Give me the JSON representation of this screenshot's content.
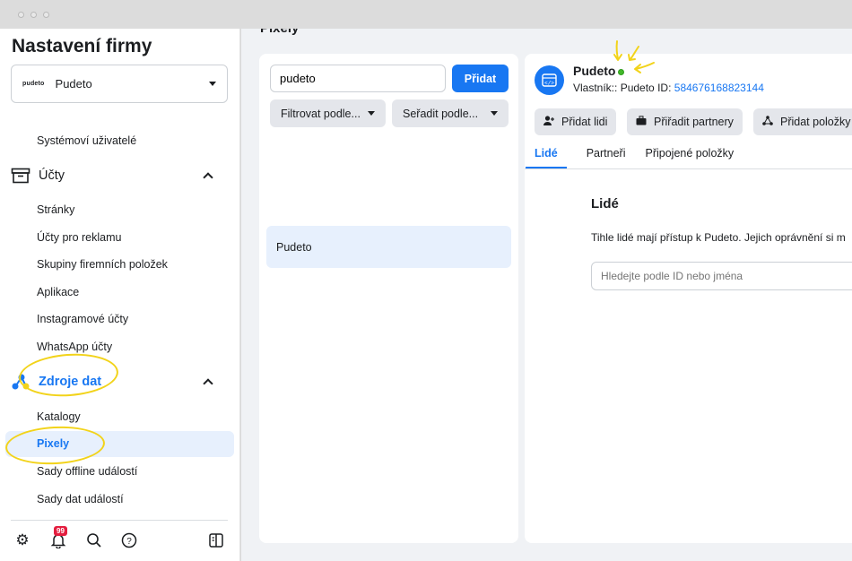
{
  "sidebar": {
    "title": "Nastavení firmy",
    "business": {
      "logo_text": "pudeto",
      "name": "Pudeto"
    },
    "system_users": "Systémoví uživatelé",
    "accounts_section": "Účty",
    "accounts_items": [
      "Stránky",
      "Účty pro reklamu",
      "Skupiny firemních položek",
      "Aplikace",
      "Instagramové účty",
      "WhatsApp účty"
    ],
    "data_sources_section": "Zdroje dat",
    "data_sources_items": [
      "Katalogy",
      "Pixely",
      "Sady offline událostí",
      "Sady dat událostí"
    ],
    "active_item": "Pixely",
    "footer": {
      "notification_count": "99"
    }
  },
  "main": {
    "page_title": "Pixely",
    "search": {
      "value": "pudeto"
    },
    "add_button": "Přidat",
    "filter_button": "Filtrovat podle...",
    "sort_button": "Seřadit podle...",
    "list": [
      "Pudeto"
    ]
  },
  "detail": {
    "name": "Pudeto",
    "owner_label": "Vlastník:: Pudeto",
    "id_label": "ID:",
    "id_value": "584676168823144",
    "actions": [
      "Přidat lidi",
      "Přiřadit partnery",
      "Přidat položky"
    ],
    "tabs": [
      "Lidé",
      "Partneři",
      "Připojené položky"
    ],
    "active_tab": "Lidé",
    "people_title": "Lidé",
    "people_desc": "Tihle lidé mají přístup k Pudeto. Jejich oprávnění si m",
    "people_search_placeholder": "Hledejte podle ID nebo jména"
  },
  "colors": {
    "accent": "#1877f2",
    "highlight": "#f2d31a",
    "status": "#42b72a",
    "badge": "#e41e3f"
  }
}
